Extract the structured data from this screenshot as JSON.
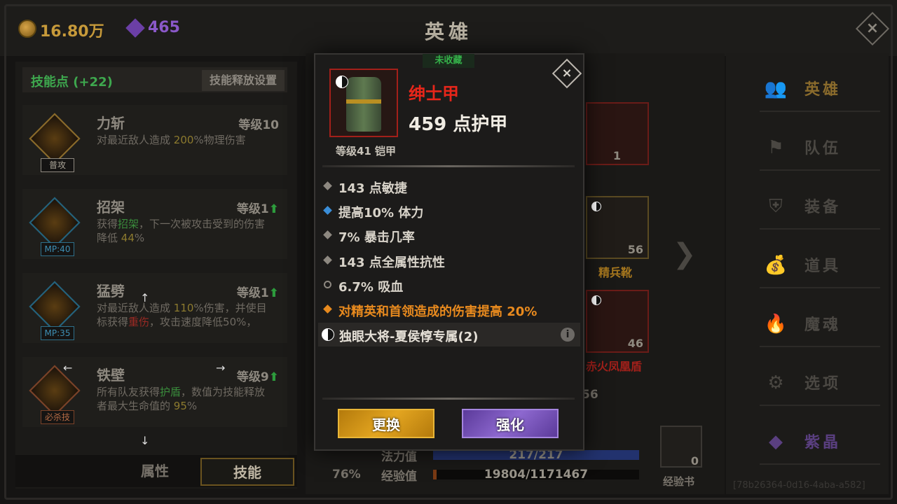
{
  "header": {
    "gold": "16.80万",
    "gems": "465",
    "title": "英雄",
    "close_icon": "×"
  },
  "skills_panel": {
    "skill_points": "技能点 (+22)",
    "release_settings": "技能释放设置",
    "skills": [
      {
        "name": "力斩",
        "level": "等级10",
        "tag": "普攻",
        "desc_pre": "对最近敌人造成 ",
        "desc_hl": "200",
        "desc_post": "%物理伤害",
        "line2": ""
      },
      {
        "name": "招架",
        "level": "等级1",
        "tag": "MP:40",
        "desc_pre": "获得",
        "desc_hl": "招架",
        "desc_post": "，下一次被攻击受到的伤害",
        "line2_pre": "降低 ",
        "line2_hl": "44",
        "line2_post": "%"
      },
      {
        "name": "猛劈",
        "level": "等级1",
        "tag": "MP:35",
        "desc_pre": "对最近敌人造成 ",
        "desc_hl": "110",
        "desc_post": "%伤害，并使目",
        "line2_pre": "标获得",
        "line2_hl": "重伤",
        "line2_post": "，攻击速度降低50%，"
      },
      {
        "name": "铁壁",
        "level": "等级9",
        "tag": "必杀技",
        "desc_pre": "所有队友获得",
        "desc_hl": "护盾",
        "desc_post": "，数值为技能释放",
        "line2_pre": "者最大生命值的 ",
        "line2_hl": "95",
        "line2_post": "%"
      }
    ],
    "up_arrow": "⬆",
    "arrows": {
      "up": "↑",
      "left": "←",
      "right": "→",
      "down": "↓"
    },
    "tabs": [
      "属性",
      "技能"
    ]
  },
  "equipment": {
    "slots": [
      {
        "num": "1",
        "label": ""
      },
      {
        "num": "56",
        "label": "精兵靴"
      },
      {
        "num": "46",
        "label": "赤火凤凰盾"
      }
    ],
    "next_chevron": "❯",
    "partial_num": "56",
    "crit_pct": "76%",
    "mp_label": "法力值",
    "mp_value": "217/217",
    "mp_fraction": 1.0,
    "xp_label": "经验值",
    "xp_value": "19804/1171467",
    "xp_fraction": 0.017,
    "xp_book_label": "经验书",
    "xp_book_count": "0"
  },
  "nav": {
    "items": [
      {
        "label": "英雄",
        "icon": "👥"
      },
      {
        "label": "队伍",
        "icon": "⚑"
      },
      {
        "label": "装备",
        "icon": "⛨"
      },
      {
        "label": "道具",
        "icon": "💰"
      },
      {
        "label": "魔魂",
        "icon": "🔥"
      },
      {
        "label": "选项",
        "icon": "⚙"
      },
      {
        "label": "紫晶",
        "icon": "◆"
      }
    ]
  },
  "watermark": "[78b26364-0d16-4aba-a582]",
  "popup": {
    "badge": "未收藏",
    "name": "绅士甲",
    "armor": "459 点护甲",
    "sub": "等级41 铠甲",
    "attributes": [
      "143 点敏捷",
      "提高10% 体力",
      "7% 暴击几率",
      "143 点全属性抗性",
      "6.7% 吸血",
      "对精英和首领造成的伤害提高 20%"
    ],
    "set_name": "独眼大将-夏侯惇专属(2)",
    "info_icon": "i",
    "close_icon": "×",
    "btn_replace": "更换",
    "btn_upgrade": "强化"
  }
}
